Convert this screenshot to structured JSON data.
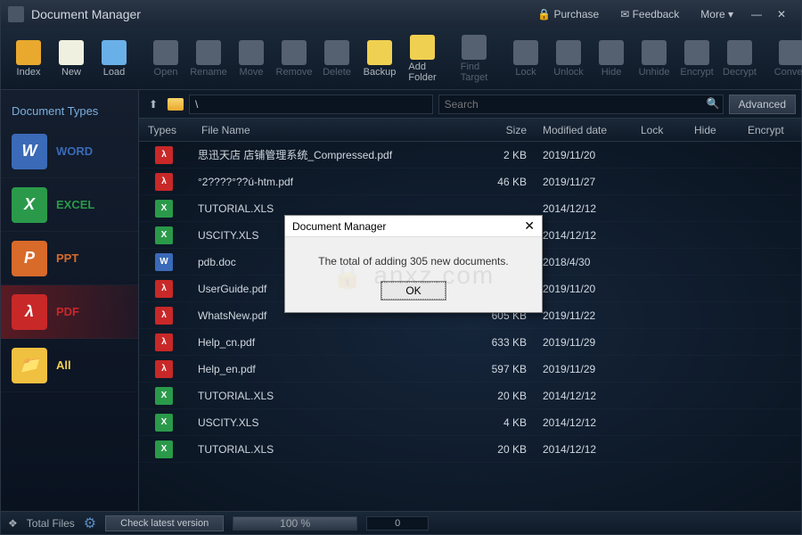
{
  "app": {
    "title": "Document Manager"
  },
  "titlebar": {
    "purchase": "Purchase",
    "feedback": "Feedback",
    "more": "More ▾"
  },
  "toolbar": {
    "items": [
      {
        "label": "Index",
        "enabled": true,
        "color": "#e8a92e"
      },
      {
        "label": "New",
        "enabled": true,
        "color": "#f0f0e0"
      },
      {
        "label": "Load",
        "enabled": true,
        "color": "#6ab0e8"
      },
      {
        "label": "Open",
        "enabled": false,
        "color": "#556070"
      },
      {
        "label": "Rename",
        "enabled": false,
        "color": "#556070"
      },
      {
        "label": "Move",
        "enabled": false,
        "color": "#556070"
      },
      {
        "label": "Remove",
        "enabled": false,
        "color": "#556070"
      },
      {
        "label": "Delete",
        "enabled": false,
        "color": "#556070"
      },
      {
        "label": "Backup",
        "enabled": true,
        "color": "#f0d050"
      },
      {
        "label": "Add Folder",
        "enabled": true,
        "color": "#f0d050"
      },
      {
        "label": "Find Target",
        "enabled": false,
        "color": "#556070"
      },
      {
        "label": "Lock",
        "enabled": false,
        "color": "#556070"
      },
      {
        "label": "Unlock",
        "enabled": false,
        "color": "#556070"
      },
      {
        "label": "Hide",
        "enabled": false,
        "color": "#556070"
      },
      {
        "label": "Unhide",
        "enabled": false,
        "color": "#556070"
      },
      {
        "label": "Encrypt",
        "enabled": false,
        "color": "#556070"
      },
      {
        "label": "Decrypt",
        "enabled": false,
        "color": "#556070"
      },
      {
        "label": "Convert",
        "enabled": false,
        "color": "#556070"
      }
    ]
  },
  "sidebar": {
    "title": "Document Types",
    "types": [
      {
        "label": "WORD",
        "color": "#3a6ab8",
        "text": "#3a6ab8",
        "glyph": "W",
        "active": false
      },
      {
        "label": "EXCEL",
        "color": "#2a9a4a",
        "text": "#2a9a4a",
        "glyph": "X",
        "active": false
      },
      {
        "label": "PPT",
        "color": "#d86a2a",
        "text": "#d86a2a",
        "glyph": "P",
        "active": false
      },
      {
        "label": "PDF",
        "color": "#c82828",
        "text": "#c82828",
        "glyph": "λ",
        "active": true
      },
      {
        "label": "All",
        "color": "#f0c040",
        "text": "#f0d050",
        "glyph": "📁",
        "active": false
      }
    ]
  },
  "pathbar": {
    "path": "\\",
    "search_placeholder": "Search",
    "advanced": "Advanced"
  },
  "columns": {
    "types": "Types",
    "name": "File Name",
    "size": "Size",
    "date": "Modified date",
    "lock": "Lock",
    "hide": "Hide",
    "enc": "Encrypt"
  },
  "files": [
    {
      "type": "pdf",
      "name": "思迅天店 店铺管理系统_Compressed.pdf",
      "size": "2 KB",
      "date": "2019/11/20"
    },
    {
      "type": "pdf",
      "name": "°2????°??ú-htm.pdf",
      "size": "46 KB",
      "date": "2019/11/27"
    },
    {
      "type": "xls",
      "name": "TUTORIAL.XLS",
      "size": "",
      "date": "2014/12/12"
    },
    {
      "type": "xls",
      "name": "USCITY.XLS",
      "size": "",
      "date": "2014/12/12"
    },
    {
      "type": "doc",
      "name": "pdb.doc",
      "size": "",
      "date": "2018/4/30"
    },
    {
      "type": "pdf",
      "name": "UserGuide.pdf",
      "size": "",
      "date": "2019/11/20"
    },
    {
      "type": "pdf",
      "name": "WhatsNew.pdf",
      "size": "605 KB",
      "date": "2019/11/22"
    },
    {
      "type": "pdf",
      "name": "Help_cn.pdf",
      "size": "633 KB",
      "date": "2019/11/29"
    },
    {
      "type": "pdf",
      "name": "Help_en.pdf",
      "size": "597 KB",
      "date": "2019/11/29"
    },
    {
      "type": "xls",
      "name": "TUTORIAL.XLS",
      "size": "20 KB",
      "date": "2014/12/12"
    },
    {
      "type": "xls",
      "name": "USCITY.XLS",
      "size": "4 KB",
      "date": "2014/12/12"
    },
    {
      "type": "xls",
      "name": "TUTORIAL.XLS",
      "size": "20 KB",
      "date": "2014/12/12"
    }
  ],
  "filetype_styles": {
    "pdf": {
      "bg": "#c82828",
      "glyph": "λ"
    },
    "xls": {
      "bg": "#2a9a4a",
      "glyph": "X"
    },
    "doc": {
      "bg": "#3a6ab8",
      "glyph": "W"
    }
  },
  "statusbar": {
    "total_files": "Total Files",
    "check": "Check latest version",
    "progress_pct": "100 %",
    "counter": "0"
  },
  "dialog": {
    "title": "Document Manager",
    "message": "The total of adding 305 new documents.",
    "ok": "OK",
    "watermark": "🔒 anxz.com"
  }
}
